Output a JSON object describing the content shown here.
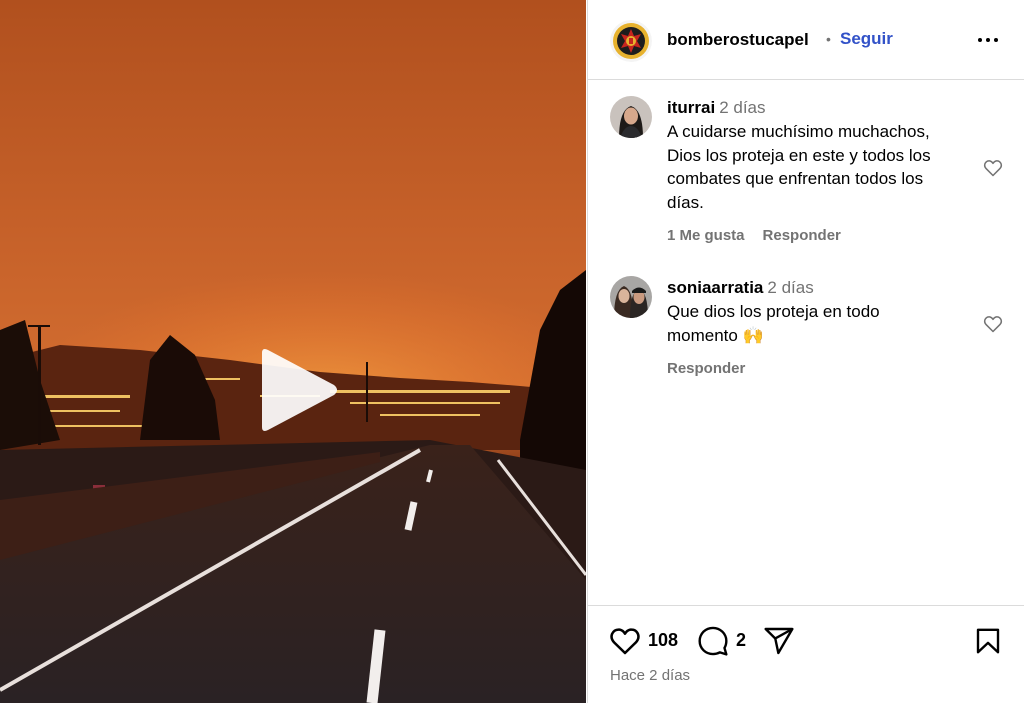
{
  "header": {
    "username": "bomberostucapel",
    "separator": "•",
    "follow_label": "Seguir"
  },
  "comments": [
    {
      "username": "iturrai",
      "time": "2 días",
      "lines": [
        "A cuidarse muchísimo muchachos,",
        "Dios los proteja en este y todos los",
        "combates que enfrentan todos los",
        "días."
      ],
      "likes_label": "1 Me gusta",
      "reply_label": "Responder"
    },
    {
      "username": "soniaarratia",
      "time": "2 días",
      "lines": [
        "Que dios los proteja en todo",
        "momento 🙌"
      ],
      "reply_label": "Responder"
    }
  ],
  "footer": {
    "like_count": "108",
    "comment_count": "2",
    "date": "Hace 2 días"
  },
  "colors": {
    "link_blue": "#3252c8",
    "muted": "#737373",
    "border": "#dbdbdb"
  },
  "icons": [
    "play-icon",
    "more-options-icon",
    "heart-icon",
    "comment-icon",
    "share-icon",
    "bookmark-icon"
  ]
}
